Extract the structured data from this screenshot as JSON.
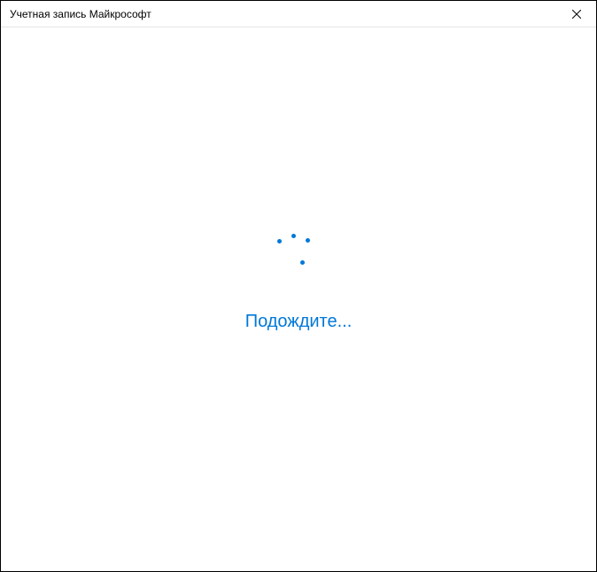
{
  "window": {
    "title": "Учетная запись Майкрософт"
  },
  "content": {
    "loading_text": "Подождите..."
  },
  "colors": {
    "accent": "#0078d7"
  }
}
